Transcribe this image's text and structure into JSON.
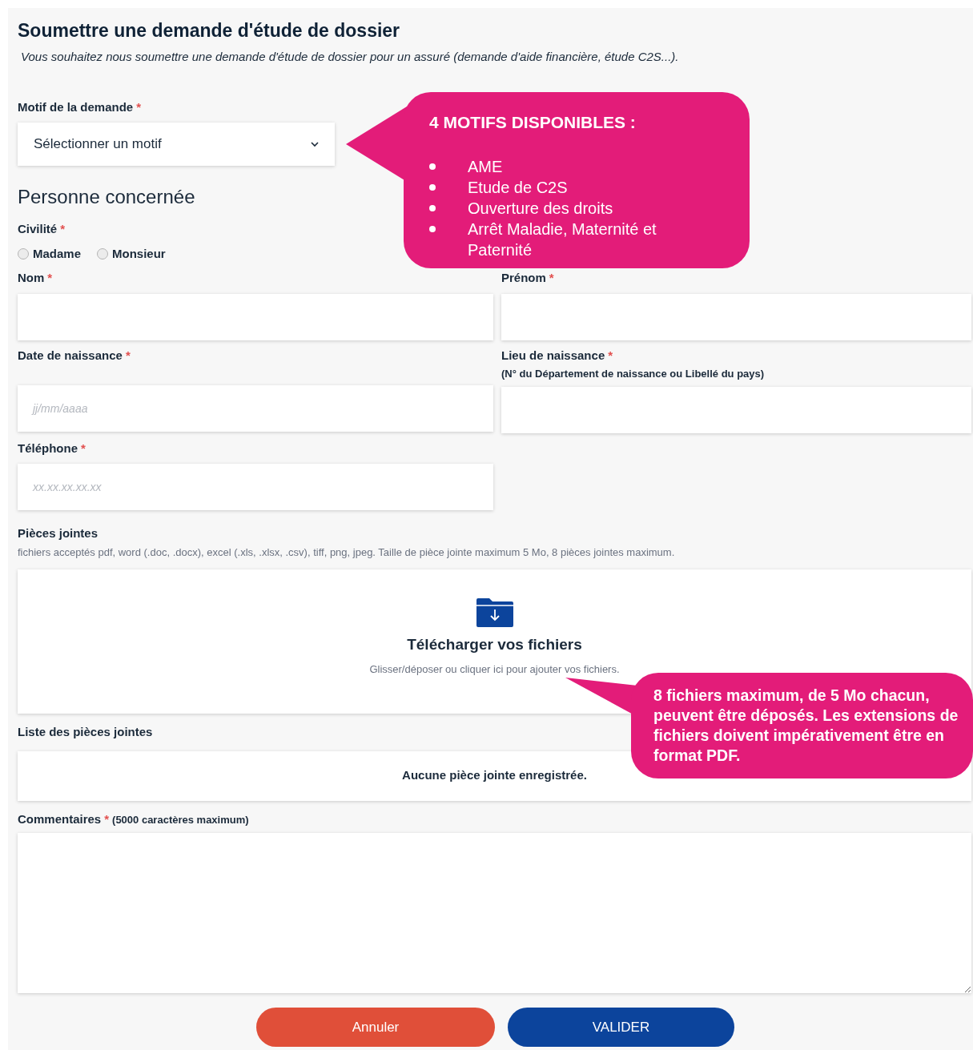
{
  "title": "Soumettre une demande d'étude de dossier",
  "subtitle": "Vous souhaitez nous soumettre une demande d'étude de dossier pour un assuré (demande d'aide financière, étude C2S...).",
  "required_mark": "*",
  "motif": {
    "label": "Motif de la demande",
    "required": true,
    "value": "Sélectionner un motif"
  },
  "section_title": "Personne concernée",
  "civilite": {
    "label": "Civilité",
    "required": true,
    "options": [
      {
        "label": "Madame",
        "selected": false
      },
      {
        "label": "Monsieur",
        "selected": false
      }
    ]
  },
  "fields": [
    {
      "label": "Nom",
      "required": true
    },
    {
      "label": "Prénom",
      "required": true
    },
    {
      "label": "Date de naissance",
      "required": true,
      "placeholder": "jj/mm/aaaa"
    },
    {
      "label": "Lieu de naissance",
      "required": true,
      "hint": "(N° du Département de naissance ou Libellé du pays)"
    },
    {
      "label": "Téléphone",
      "required": true,
      "placeholder": "xx.xx.xx.xx.xx"
    }
  ],
  "attachments": {
    "label": "Pièces jointes",
    "note": "fichiers acceptés pdf, word (.doc, .docx), excel (.xls, .xlsx, .csv), tiff, png, jpeg. Taille de pièce jointe maximum 5 Mo, 8 pièces jointes maximum.",
    "dropzone_title": "Télécharger vos fichiers",
    "dropzone_text": "Glisser/déposer ou cliquer ici pour ajouter vos fichiers."
  },
  "attachment_list": {
    "label": "Liste des pièces jointes",
    "empty_text": "Aucune pièce jointe enregistrée."
  },
  "comments": {
    "label": "Commentaires",
    "required": true,
    "note": "(5000 caractères maximum)"
  },
  "buttons": [
    {
      "label": "Annuler",
      "kind": "cancel"
    },
    {
      "label": "VALIDER",
      "kind": "submit"
    }
  ],
  "callouts": [
    {
      "kind": "list",
      "title": "4 MOTIFS DISPONIBLES :",
      "items": [
        "AME",
        "Etude de C2S",
        "Ouverture des droits",
        "Arrêt Maladie, Maternité et Paternité"
      ]
    },
    {
      "kind": "text",
      "text": "8 fichiers maximum, de 5 Mo chacun, peuvent être déposés. Les extensions de fichiers doivent impérativement être en format PDF."
    }
  ]
}
